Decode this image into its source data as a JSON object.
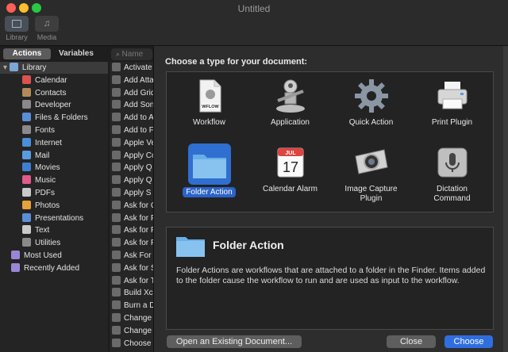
{
  "window": {
    "title": "Untitled"
  },
  "toolbar": {
    "library_label": "Library",
    "media_label": "Media"
  },
  "sidebar": {
    "tab_actions": "Actions",
    "tab_variables": "Variables",
    "search_placeholder": "Name",
    "library": [
      {
        "label": "Library",
        "color": "#7aa7d6"
      },
      {
        "label": "Calendar",
        "color": "#d9534f"
      },
      {
        "label": "Contacts",
        "color": "#b48a5a"
      },
      {
        "label": "Developer",
        "color": "#8a8a8a"
      },
      {
        "label": "Files & Folders",
        "color": "#5a8fd6"
      },
      {
        "label": "Fonts",
        "color": "#8a8a8a"
      },
      {
        "label": "Internet",
        "color": "#4b8fd8"
      },
      {
        "label": "Mail",
        "color": "#5a9be0"
      },
      {
        "label": "Movies",
        "color": "#3f7fd0"
      },
      {
        "label": "Music",
        "color": "#e05a8a"
      },
      {
        "label": "PDFs",
        "color": "#c9c9c9"
      },
      {
        "label": "Photos",
        "color": "#e6a23c"
      },
      {
        "label": "Presentations",
        "color": "#5a8fd6"
      },
      {
        "label": "Text",
        "color": "#c9c9c9"
      },
      {
        "label": "Utilities",
        "color": "#8a8a8a"
      },
      {
        "label": "Most Used",
        "color": "#9a86d6"
      },
      {
        "label": "Recently Added",
        "color": "#9a86d6"
      }
    ],
    "actions": [
      "Activate",
      "Add Atta",
      "Add Grid",
      "Add Son",
      "Add to A",
      "Add to F",
      "Apple Ve",
      "Apply Co",
      "Apply Q",
      "Apply Q",
      "Apply S",
      "Ask for C",
      "Ask for F",
      "Ask for F",
      "Ask for F",
      "Ask For",
      "Ask for S",
      "Ask for T",
      "Build Xc",
      "Burn a D",
      "Change",
      "Change",
      "Choose"
    ]
  },
  "dialog": {
    "heading": "Choose a type for your document:",
    "types": [
      {
        "label": "Workflow",
        "icon": "workflow-icon",
        "badge": "WFLOW"
      },
      {
        "label": "Application",
        "icon": "application-robot-icon"
      },
      {
        "label": "Quick Action",
        "icon": "gear-icon"
      },
      {
        "label": "Print Plugin",
        "icon": "printer-icon"
      },
      {
        "label": "Folder Action",
        "icon": "folder-icon",
        "selected": true
      },
      {
        "label": "Calendar Alarm",
        "icon": "calendar-icon",
        "month": "JUL",
        "day": "17"
      },
      {
        "label": "Image Capture Plugin",
        "icon": "camera-icon"
      },
      {
        "label": "Dictation Command",
        "icon": "microphone-icon"
      }
    ],
    "description": {
      "title": "Folder Action",
      "text": "Folder Actions are workflows that are attached to a folder in the Finder. Items added to the folder cause the workflow to run and are used as input to the workflow."
    },
    "buttons": {
      "open_existing": "Open an Existing Document...",
      "close": "Close",
      "choose": "Choose"
    },
    "accent_color": "#2f6ee0"
  }
}
